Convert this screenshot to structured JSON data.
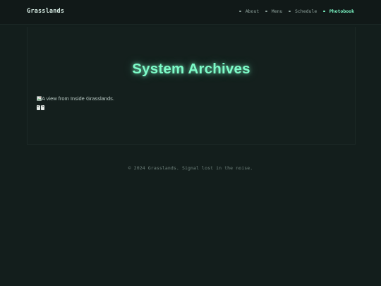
{
  "header": {
    "brand": "Grasslands",
    "nav": [
      {
        "label": "About",
        "active": false
      },
      {
        "label": "Menu",
        "active": false
      },
      {
        "label": "Schedule",
        "active": false
      },
      {
        "label": "Photobook",
        "active": true
      }
    ]
  },
  "main": {
    "title": "System Archives",
    "image_alt": "A view from Inside Grasslands.",
    "controls": {
      "prev": "<",
      "next": ">"
    }
  },
  "footer": {
    "text": "© 2024 Grasslands. Signal lost in the noise."
  },
  "colors": {
    "background": "#131e1c",
    "accent": "#7dfbc8",
    "nav_text": "#8ea29c",
    "footer_text": "#6f827c"
  },
  "icons": [
    "broken-image-icon",
    "chevron-left-icon",
    "chevron-right-icon",
    "nav-dot-icon"
  ]
}
